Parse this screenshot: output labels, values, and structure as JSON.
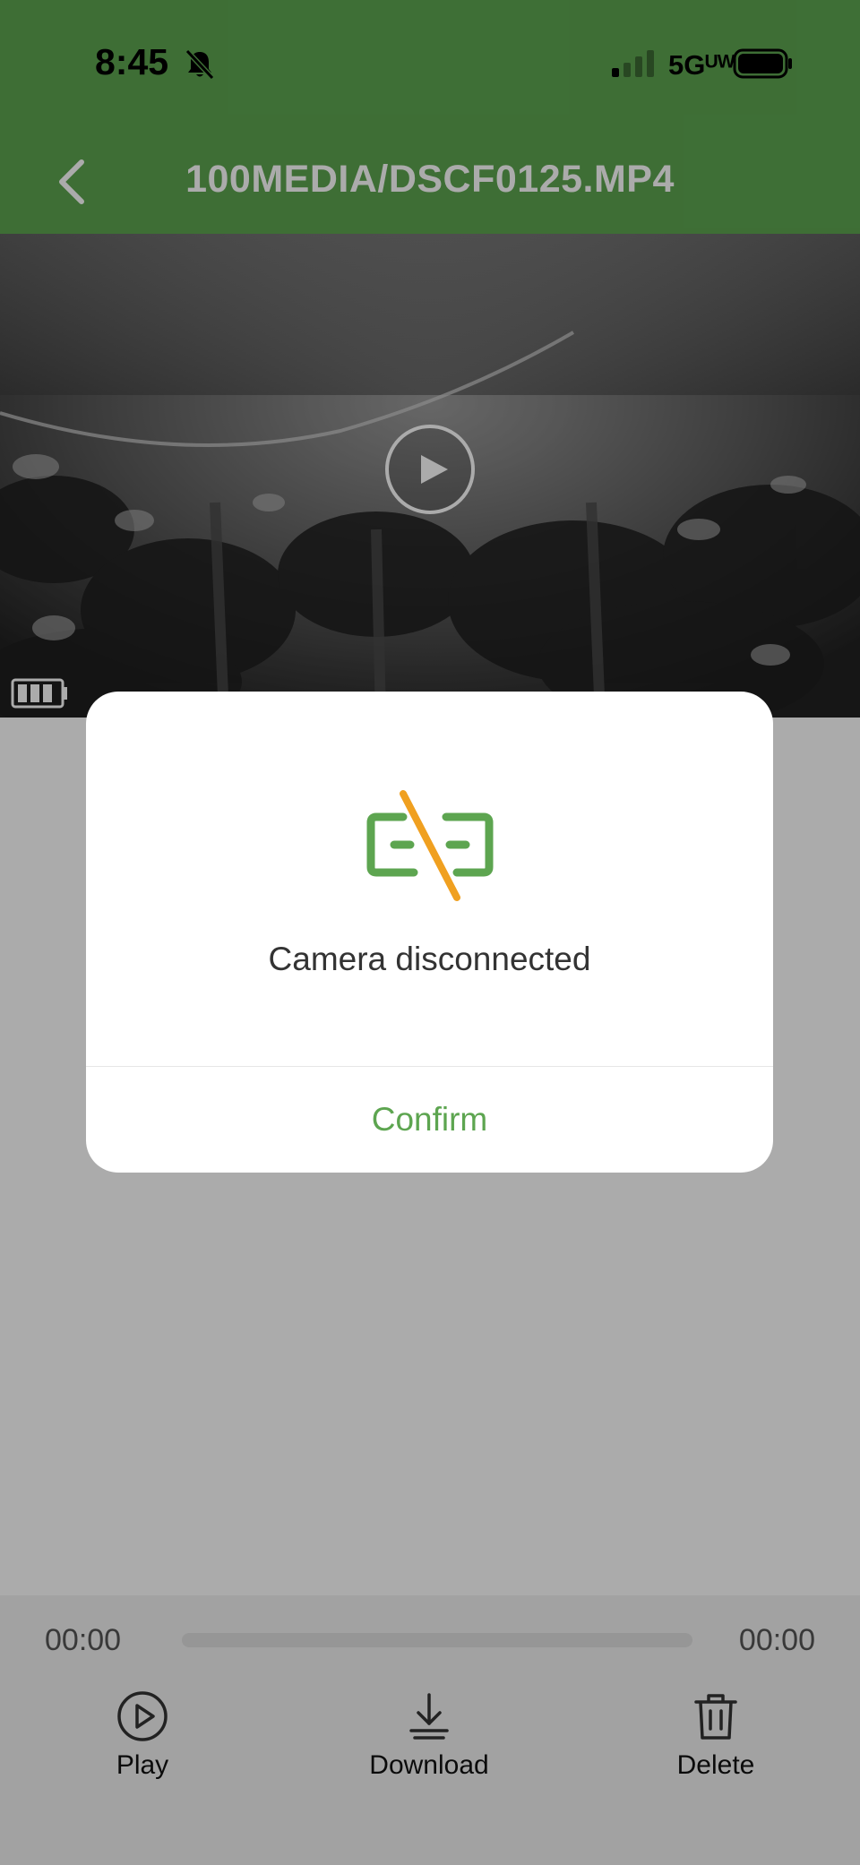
{
  "status_bar": {
    "time": "8:45",
    "network": "5Gᵁᵂ",
    "icons": [
      "bell-muted-icon",
      "signal-icon",
      "battery-icon"
    ]
  },
  "header": {
    "title": "100MEDIA/DSCF0125.MP4",
    "back_icon": "chevron-left-icon",
    "background_color": "#5da550"
  },
  "video": {
    "overlay_icon": "play-circle-icon",
    "osd_icon": "battery-level-icon"
  },
  "player": {
    "current_time": "00:00",
    "total_time": "00:00",
    "progress": 0,
    "actions": [
      {
        "label": "Play",
        "icon": "play-circle-icon"
      },
      {
        "label": "Download",
        "icon": "download-icon"
      },
      {
        "label": "Delete",
        "icon": "trash-icon"
      }
    ]
  },
  "dialog": {
    "icon": "camera-disconnected-icon",
    "message": "Camera disconnected",
    "confirm_label": "Confirm",
    "accent_color": "#5da550",
    "slash_color": "#f0a020"
  }
}
